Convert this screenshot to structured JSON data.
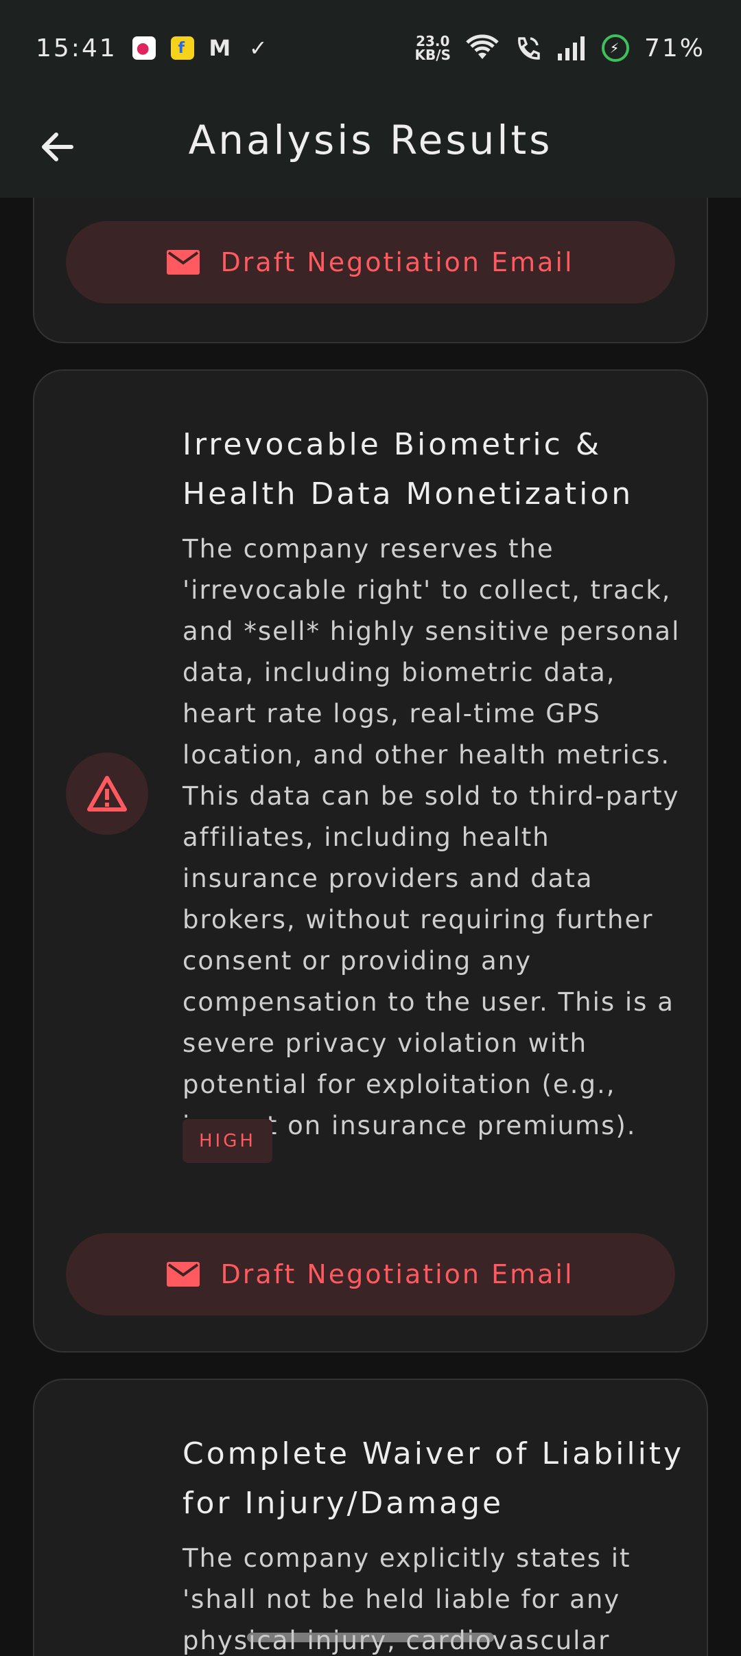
{
  "status_bar": {
    "time": "15:41",
    "net_speed_value": "23.0",
    "net_speed_unit": "KB/S",
    "battery": "71%",
    "icons": [
      "shopping-bag-icon",
      "flipkart-icon",
      "gmail-icon",
      "checkmark-icon",
      "wifi-icon",
      "wifi-call-icon",
      "signal-icon",
      "battery-charging-icon"
    ]
  },
  "app_bar": {
    "title": "Analysis Results",
    "back_icon": "arrow-back-icon"
  },
  "cards": [
    {
      "action_label": "Draft Negotiation Email"
    },
    {
      "title": "Irrevocable Biometric & Health Data Monetization",
      "description": "The company reserves the 'irrevocable right' to collect, track, and *sell* highly sensitive personal data, including biometric data, heart rate logs, real-time GPS location, and other health metrics. This data can be sold to third-party affiliates, including health insurance providers and data brokers, without requiring further consent or providing any compensation to the user. This is a severe privacy violation with potential for exploitation (e.g., impact on insurance premiums).",
      "severity": "HIGH",
      "icon": "warning-icon",
      "action_label": "Draft Negotiation Email"
    },
    {
      "title": "Complete Waiver of Liability for Injury/Damage",
      "description": "The company explicitly states it 'shall not be held liable for any physical injury, cardiovascular event,"
    }
  ],
  "colors": {
    "accent": "#ff5a5f",
    "card_bg": "#1e1e1e",
    "bar_bg": "#1d211f",
    "badge_bg": "#3a2425"
  }
}
